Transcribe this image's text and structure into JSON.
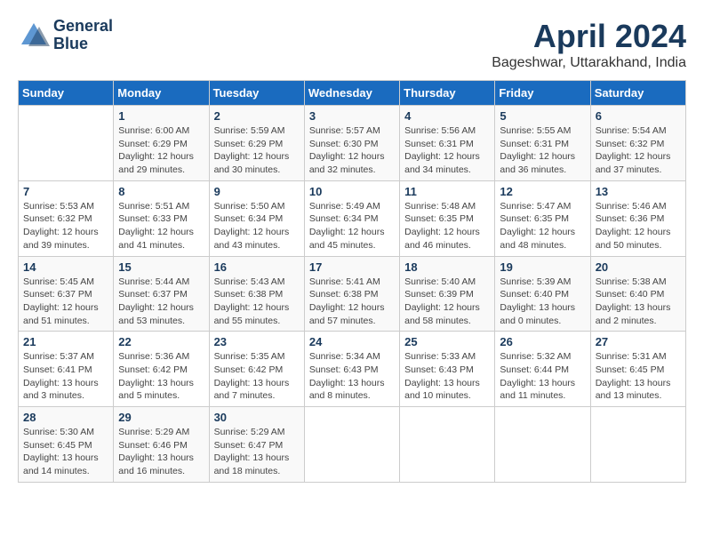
{
  "header": {
    "logo_line1": "General",
    "logo_line2": "Blue",
    "month": "April 2024",
    "location": "Bageshwar, Uttarakhand, India"
  },
  "days_of_week": [
    "Sunday",
    "Monday",
    "Tuesday",
    "Wednesday",
    "Thursday",
    "Friday",
    "Saturday"
  ],
  "weeks": [
    [
      {
        "day": "",
        "info": ""
      },
      {
        "day": "1",
        "info": "Sunrise: 6:00 AM\nSunset: 6:29 PM\nDaylight: 12 hours\nand 29 minutes."
      },
      {
        "day": "2",
        "info": "Sunrise: 5:59 AM\nSunset: 6:29 PM\nDaylight: 12 hours\nand 30 minutes."
      },
      {
        "day": "3",
        "info": "Sunrise: 5:57 AM\nSunset: 6:30 PM\nDaylight: 12 hours\nand 32 minutes."
      },
      {
        "day": "4",
        "info": "Sunrise: 5:56 AM\nSunset: 6:31 PM\nDaylight: 12 hours\nand 34 minutes."
      },
      {
        "day": "5",
        "info": "Sunrise: 5:55 AM\nSunset: 6:31 PM\nDaylight: 12 hours\nand 36 minutes."
      },
      {
        "day": "6",
        "info": "Sunrise: 5:54 AM\nSunset: 6:32 PM\nDaylight: 12 hours\nand 37 minutes."
      }
    ],
    [
      {
        "day": "7",
        "info": "Sunrise: 5:53 AM\nSunset: 6:32 PM\nDaylight: 12 hours\nand 39 minutes."
      },
      {
        "day": "8",
        "info": "Sunrise: 5:51 AM\nSunset: 6:33 PM\nDaylight: 12 hours\nand 41 minutes."
      },
      {
        "day": "9",
        "info": "Sunrise: 5:50 AM\nSunset: 6:34 PM\nDaylight: 12 hours\nand 43 minutes."
      },
      {
        "day": "10",
        "info": "Sunrise: 5:49 AM\nSunset: 6:34 PM\nDaylight: 12 hours\nand 45 minutes."
      },
      {
        "day": "11",
        "info": "Sunrise: 5:48 AM\nSunset: 6:35 PM\nDaylight: 12 hours\nand 46 minutes."
      },
      {
        "day": "12",
        "info": "Sunrise: 5:47 AM\nSunset: 6:35 PM\nDaylight: 12 hours\nand 48 minutes."
      },
      {
        "day": "13",
        "info": "Sunrise: 5:46 AM\nSunset: 6:36 PM\nDaylight: 12 hours\nand 50 minutes."
      }
    ],
    [
      {
        "day": "14",
        "info": "Sunrise: 5:45 AM\nSunset: 6:37 PM\nDaylight: 12 hours\nand 51 minutes."
      },
      {
        "day": "15",
        "info": "Sunrise: 5:44 AM\nSunset: 6:37 PM\nDaylight: 12 hours\nand 53 minutes."
      },
      {
        "day": "16",
        "info": "Sunrise: 5:43 AM\nSunset: 6:38 PM\nDaylight: 12 hours\nand 55 minutes."
      },
      {
        "day": "17",
        "info": "Sunrise: 5:41 AM\nSunset: 6:38 PM\nDaylight: 12 hours\nand 57 minutes."
      },
      {
        "day": "18",
        "info": "Sunrise: 5:40 AM\nSunset: 6:39 PM\nDaylight: 12 hours\nand 58 minutes."
      },
      {
        "day": "19",
        "info": "Sunrise: 5:39 AM\nSunset: 6:40 PM\nDaylight: 13 hours\nand 0 minutes."
      },
      {
        "day": "20",
        "info": "Sunrise: 5:38 AM\nSunset: 6:40 PM\nDaylight: 13 hours\nand 2 minutes."
      }
    ],
    [
      {
        "day": "21",
        "info": "Sunrise: 5:37 AM\nSunset: 6:41 PM\nDaylight: 13 hours\nand 3 minutes."
      },
      {
        "day": "22",
        "info": "Sunrise: 5:36 AM\nSunset: 6:42 PM\nDaylight: 13 hours\nand 5 minutes."
      },
      {
        "day": "23",
        "info": "Sunrise: 5:35 AM\nSunset: 6:42 PM\nDaylight: 13 hours\nand 7 minutes."
      },
      {
        "day": "24",
        "info": "Sunrise: 5:34 AM\nSunset: 6:43 PM\nDaylight: 13 hours\nand 8 minutes."
      },
      {
        "day": "25",
        "info": "Sunrise: 5:33 AM\nSunset: 6:43 PM\nDaylight: 13 hours\nand 10 minutes."
      },
      {
        "day": "26",
        "info": "Sunrise: 5:32 AM\nSunset: 6:44 PM\nDaylight: 13 hours\nand 11 minutes."
      },
      {
        "day": "27",
        "info": "Sunrise: 5:31 AM\nSunset: 6:45 PM\nDaylight: 13 hours\nand 13 minutes."
      }
    ],
    [
      {
        "day": "28",
        "info": "Sunrise: 5:30 AM\nSunset: 6:45 PM\nDaylight: 13 hours\nand 14 minutes."
      },
      {
        "day": "29",
        "info": "Sunrise: 5:29 AM\nSunset: 6:46 PM\nDaylight: 13 hours\nand 16 minutes."
      },
      {
        "day": "30",
        "info": "Sunrise: 5:29 AM\nSunset: 6:47 PM\nDaylight: 13 hours\nand 18 minutes."
      },
      {
        "day": "",
        "info": ""
      },
      {
        "day": "",
        "info": ""
      },
      {
        "day": "",
        "info": ""
      },
      {
        "day": "",
        "info": ""
      }
    ]
  ]
}
